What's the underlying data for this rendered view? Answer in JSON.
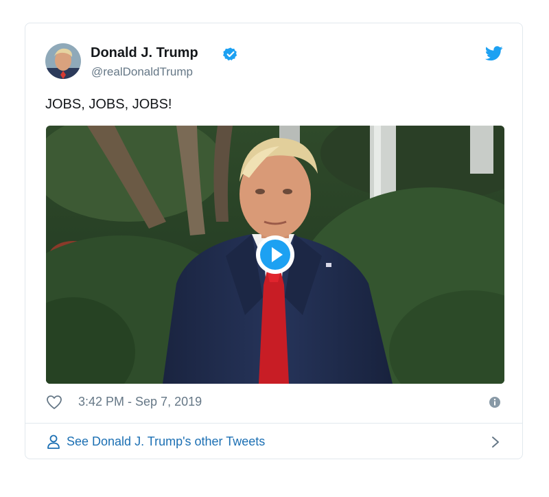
{
  "tweet": {
    "author_name": "Donald J. Trump",
    "handle": "@realDonaldTrump",
    "text": "JOBS, JOBS, JOBS!",
    "timestamp": "3:42 PM - Sep 7, 2019"
  },
  "footer": {
    "link_text": "See Donald J. Trump's other Tweets"
  },
  "icons": {
    "verified": "verified-badge-icon",
    "logo": "twitter-bird-icon",
    "like": "heart-icon",
    "info": "info-icon",
    "play": "play-icon",
    "profile": "person-icon",
    "chevron": "chevron-right-icon"
  },
  "colors": {
    "brand_blue": "#1da1f2",
    "link_blue": "#1b6fb3",
    "text_primary": "#14171a",
    "text_secondary": "#657786",
    "border": "#e1e8ed"
  }
}
